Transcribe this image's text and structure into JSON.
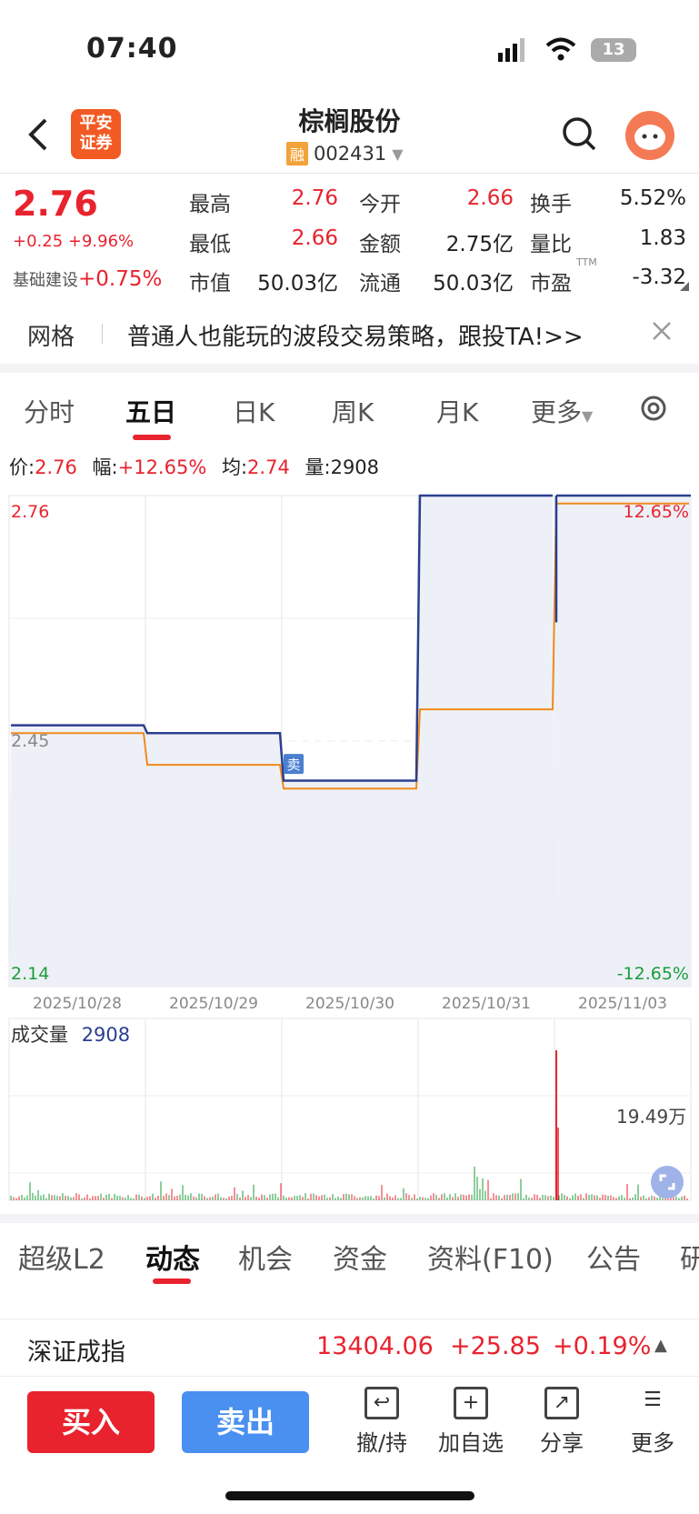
{
  "status": {
    "time": "07:40",
    "battery": "13"
  },
  "header": {
    "title": "棕榈股份",
    "badge": "融",
    "code": "002431",
    "logo_line1": "平安",
    "logo_line2": "证券"
  },
  "quote": {
    "price": "2.76",
    "change": "+0.25 +9.96%",
    "sector_label": "基础建设",
    "sector_change": "+0.75%",
    "rows": [
      [
        {
          "label": "最高",
          "value": "2.76",
          "cls": "red"
        },
        {
          "label": "今开",
          "value": "2.66",
          "cls": "red"
        },
        {
          "label": "换手",
          "value": "5.52%",
          "cls": ""
        }
      ],
      [
        {
          "label": "最低",
          "value": "2.66",
          "cls": "red"
        },
        {
          "label": "金额",
          "value": "2.75亿",
          "cls": ""
        },
        {
          "label": "量比",
          "value": "1.83",
          "cls": ""
        }
      ],
      [
        {
          "label": "市值",
          "value": "50.03亿",
          "cls": ""
        },
        {
          "label": "流通",
          "value": "50.03亿",
          "cls": ""
        },
        {
          "label": "市盈",
          "value": "-3.32",
          "cls": ""
        }
      ]
    ],
    "pe_sup": "TTM"
  },
  "banner": {
    "label": "网格",
    "text": "普通人也能玩的波段交易策略，跟投TA!>>"
  },
  "chart_tabs": [
    "分时",
    "五日",
    "日K",
    "周K",
    "月K",
    "更多"
  ],
  "info": {
    "price_label": "价:",
    "price": "2.76",
    "amp_label": "幅:",
    "amp": "+12.65%",
    "avg_label": "均:",
    "avg": "2.74",
    "vol_label": "量:",
    "vol": "2908"
  },
  "chart_data": {
    "type": "line",
    "x": [
      "2025/10/28",
      "2025/10/29",
      "2025/10/30",
      "2025/10/31",
      "2025/11/03"
    ],
    "ylim": [
      2.14,
      2.76
    ],
    "y_ticks": [
      "2.76",
      "2.45",
      "2.14"
    ],
    "right_ticks": [
      "12.65%",
      "-12.65%"
    ],
    "series": [
      {
        "values": [
          2.47,
          2.46,
          2.4,
          2.76
        ]
      },
      {
        "values": [
          2.46,
          2.42,
          2.39,
          2.49,
          2.75
        ]
      }
    ],
    "sell_marker": "卖",
    "colors": {
      "price": "#2a3f8f",
      "avg": "#f08a1c"
    }
  },
  "volume": {
    "label": "成交量",
    "value": "2908",
    "max_label": "19.49万"
  },
  "info_tabs": [
    "超级L2",
    "动态",
    "机会",
    "资金",
    "资料(F10)",
    "公告",
    "研"
  ],
  "index": {
    "name": "深证成指",
    "value": "13404.06",
    "change": "+25.85",
    "pct": "+0.19%"
  },
  "actions": {
    "buy": "买入",
    "sell": "卖出",
    "tools": [
      "撤/持",
      "加自选",
      "分享",
      "更多"
    ]
  }
}
